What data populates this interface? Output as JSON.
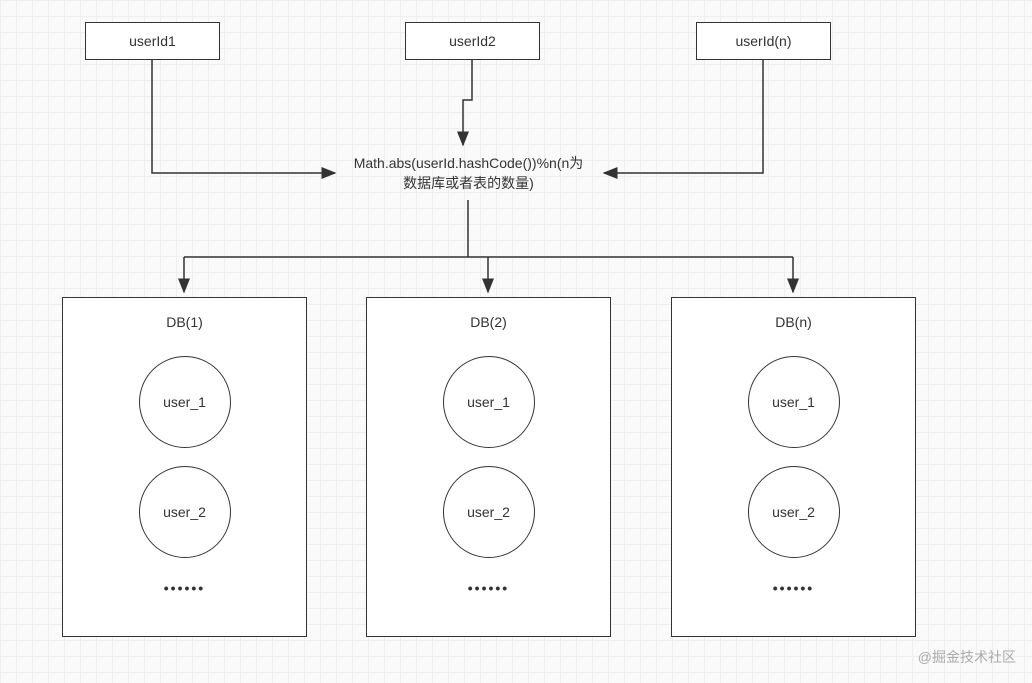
{
  "inputs": {
    "userId1": "userId1",
    "userId2": "userId2",
    "userIdN": "userId(n)"
  },
  "formula": {
    "line1": "Math.abs(userId.hashCode())%n(n为",
    "line2": "数据库或者表的数量)"
  },
  "databases": [
    {
      "title": "DB(1)",
      "tables": [
        "user_1",
        "user_2"
      ],
      "dots": "••••••"
    },
    {
      "title": "DB(2)",
      "tables": [
        "user_1",
        "user_2"
      ],
      "dots": "••••••"
    },
    {
      "title": "DB(n)",
      "tables": [
        "user_1",
        "user_2"
      ],
      "dots": "••••••"
    }
  ],
  "watermark": "@掘金技术社区"
}
